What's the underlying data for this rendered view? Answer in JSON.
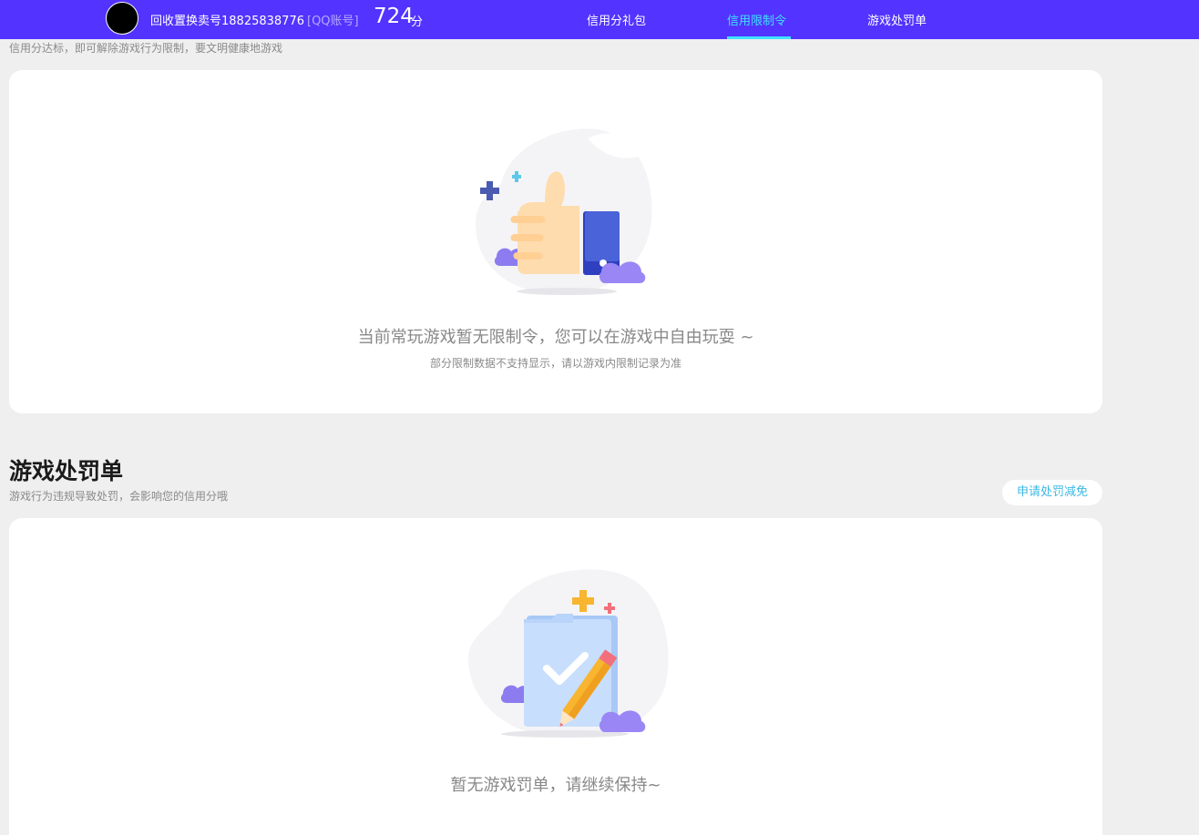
{
  "header": {
    "username": "回收置换卖号18825838776",
    "account_type": "[QQ账号]",
    "score": "724",
    "score_unit": "分",
    "tabs": [
      {
        "label": "信用分礼包",
        "active": false
      },
      {
        "label": "信用限制令",
        "active": true
      },
      {
        "label": "游戏处罚单",
        "active": false
      }
    ],
    "colors": {
      "bar": "#5233ff",
      "active_tab": "#3fe2ff"
    }
  },
  "restrictions": {
    "hint": "信用分达标，即可解除游戏行为限制，要文明健康地游戏",
    "empty_title": "当前常玩游戏暂无限制令，您可以在游戏中自由玩耍 ~",
    "empty_sub": "部分限制数据不支持显示，请以游戏内限制记录为准",
    "illustration": "thumbs-up-illustration"
  },
  "penalties": {
    "title": "游戏处罚单",
    "subtitle": "游戏行为违规导致处罚，会影响您的信用分哦",
    "appeal_button": "申请处罚减免",
    "empty_title": "暂无游戏罚单，请继续保持~",
    "illustration": "folder-check-pencil-illustration"
  }
}
